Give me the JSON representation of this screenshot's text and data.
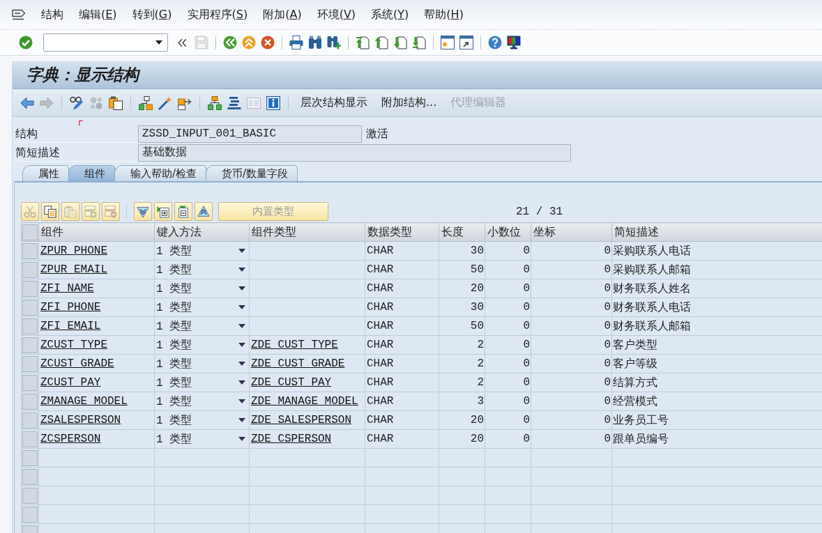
{
  "menu_bar": {
    "items": [
      {
        "label": "结构"
      },
      {
        "label": "编辑(",
        "mnemonic": "E",
        "suffix": ")"
      },
      {
        "label": "转到(",
        "mnemonic": "G",
        "suffix": ")"
      },
      {
        "label": "实用程序(",
        "mnemonic": "S",
        "suffix": ")"
      },
      {
        "label": "附加(",
        "mnemonic": "A",
        "suffix": ")"
      },
      {
        "label": "环境(",
        "mnemonic": "V",
        "suffix": ")"
      },
      {
        "label": "系统(",
        "mnemonic": "Y",
        "suffix": ")"
      },
      {
        "label": "帮助(",
        "mnemonic": "H",
        "suffix": ")"
      }
    ]
  },
  "system_toolbar": {
    "items": [
      {
        "kind": "button",
        "disabled": false
      },
      {
        "kind": "field"
      },
      {
        "kind": "button",
        "disabled": false
      },
      {
        "kind": "button",
        "disabled": true
      },
      {
        "kind": "separator"
      },
      {
        "kind": "button",
        "disabled": false
      },
      {
        "kind": "button",
        "disabled": false
      },
      {
        "kind": "button",
        "disabled": false
      },
      {
        "kind": "separator"
      },
      {
        "kind": "button",
        "disabled": false
      },
      {
        "kind": "button",
        "disabled": false
      },
      {
        "kind": "button",
        "disabled": false
      },
      {
        "kind": "separator"
      },
      {
        "kind": "button",
        "disabled": false
      },
      {
        "kind": "button",
        "disabled": false
      },
      {
        "kind": "button",
        "disabled": false
      },
      {
        "kind": "button",
        "disabled": false
      },
      {
        "kind": "separator"
      },
      {
        "kind": "button",
        "disabled": false
      },
      {
        "kind": "button",
        "disabled": false
      },
      {
        "kind": "separator"
      },
      {
        "kind": "button",
        "disabled": false
      },
      {
        "kind": "button",
        "disabled": false
      }
    ]
  },
  "title": "字典：显示结构",
  "application_toolbar": {
    "items": [
      {
        "kind": "button",
        "disabled": false
      },
      {
        "kind": "button",
        "disabled": true
      },
      {
        "kind": "separator"
      },
      {
        "kind": "button",
        "disabled": false
      },
      {
        "kind": "button",
        "disabled": true
      },
      {
        "kind": "button",
        "disabled": false
      },
      {
        "kind": "separator"
      },
      {
        "kind": "button",
        "disabled": false
      },
      {
        "kind": "button",
        "disabled": false
      },
      {
        "kind": "button",
        "disabled": false
      },
      {
        "kind": "separator"
      },
      {
        "kind": "button",
        "disabled": false
      },
      {
        "kind": "button",
        "disabled": false
      },
      {
        "kind": "button",
        "disabled": true
      },
      {
        "kind": "button",
        "disabled": false
      },
      {
        "kind": "separator"
      },
      {
        "kind": "text",
        "label": "层次结构显示",
        "disabled": false
      },
      {
        "kind": "text",
        "label": "附加结构...",
        "disabled": false
      },
      {
        "kind": "text",
        "label": "代理编辑器",
        "disabled": true
      }
    ]
  },
  "header_fields": [
    {
      "label": "结构",
      "value": "ZSSD_INPUT_001_BASIC",
      "status": "激活"
    },
    {
      "label": "简短描述",
      "value": "基础数据"
    }
  ],
  "tabs": [
    {
      "label": "属性",
      "selected": false
    },
    {
      "label": "组件",
      "selected": true
    },
    {
      "label": "输入帮助/检查",
      "selected": false
    },
    {
      "label": "货币/数量字段",
      "selected": false
    }
  ],
  "table_toolbar": {
    "items": [
      {
        "kind": "button",
        "disabled": true
      },
      {
        "kind": "button",
        "disabled": false
      },
      {
        "kind": "button",
        "disabled": true
      },
      {
        "kind": "button",
        "disabled": true
      },
      {
        "kind": "button",
        "disabled": true
      },
      {
        "kind": "separator"
      },
      {
        "kind": "button",
        "disabled": false
      },
      {
        "kind": "button",
        "disabled": false
      },
      {
        "kind": "button",
        "disabled": false
      },
      {
        "kind": "button",
        "disabled": false
      },
      {
        "kind": "text",
        "label": "内置类型",
        "disabled": true
      }
    ],
    "counter": "21 / 31"
  },
  "table": {
    "columns": [
      "组件",
      "键入方法",
      "组件类型",
      "数据类型",
      "长度",
      "小数位",
      "坐标",
      "简短描述"
    ],
    "rows": [
      {
        "component": "ZPUR_PHONE",
        "entry_method": "1 类型",
        "data_type": "CHAR",
        "length": "30",
        "decimals": "0",
        "coordinate": "0",
        "description": "采购联系人电话"
      },
      {
        "component": "ZPUR_EMAIL",
        "entry_method": "1 类型",
        "data_type": "CHAR",
        "length": "50",
        "decimals": "0",
        "coordinate": "0",
        "description": "采购联系人邮箱"
      },
      {
        "component": "ZFI_NAME",
        "entry_method": "1 类型",
        "data_type": "CHAR",
        "length": "20",
        "decimals": "0",
        "coordinate": "0",
        "description": "财务联系人姓名"
      },
      {
        "component": "ZFI_PHONE",
        "entry_method": "1 类型",
        "data_type": "CHAR",
        "length": "30",
        "decimals": "0",
        "coordinate": "0",
        "description": "财务联系人电话"
      },
      {
        "component": "ZFI_EMAIL",
        "entry_method": "1 类型",
        "data_type": "CHAR",
        "length": "50",
        "decimals": "0",
        "coordinate": "0",
        "description": "财务联系人邮箱"
      },
      {
        "component": "ZCUST_TYPE",
        "entry_method": "1 类型",
        "component_type": "ZDE_CUST_TYPE",
        "data_type": "CHAR",
        "length": "2",
        "decimals": "0",
        "coordinate": "0",
        "description": "客户类型"
      },
      {
        "component": "ZCUST_GRADE",
        "entry_method": "1 类型",
        "component_type": "ZDE_CUST_GRADE",
        "data_type": "CHAR",
        "length": "2",
        "decimals": "0",
        "coordinate": "0",
        "description": "客户等级"
      },
      {
        "component": "ZCUST_PAY",
        "entry_method": "1 类型",
        "component_type": "ZDE_CUST_PAY",
        "data_type": "CHAR",
        "length": "2",
        "decimals": "0",
        "coordinate": "0",
        "description": "结算方式"
      },
      {
        "component": "ZMANAGE_MODEL",
        "entry_method": "1 类型",
        "component_type": "ZDE_MANAGE_MODEL",
        "data_type": "CHAR",
        "length": "3",
        "decimals": "0",
        "coordinate": "0",
        "description": "经营模式"
      },
      {
        "component": "ZSALESPERSON",
        "entry_method": "1 类型",
        "component_type": "ZDE_SALESPERSON",
        "data_type": "CHAR",
        "length": "20",
        "decimals": "0",
        "coordinate": "0",
        "description": "业务员工号"
      },
      {
        "component": "ZCSPERSON",
        "entry_method": "1 类型",
        "component_type": "ZDE_CSPERSON",
        "data_type": "CHAR",
        "length": "20",
        "decimals": "0",
        "coordinate": "0",
        "description": "跟单员编号"
      }
    ]
  }
}
